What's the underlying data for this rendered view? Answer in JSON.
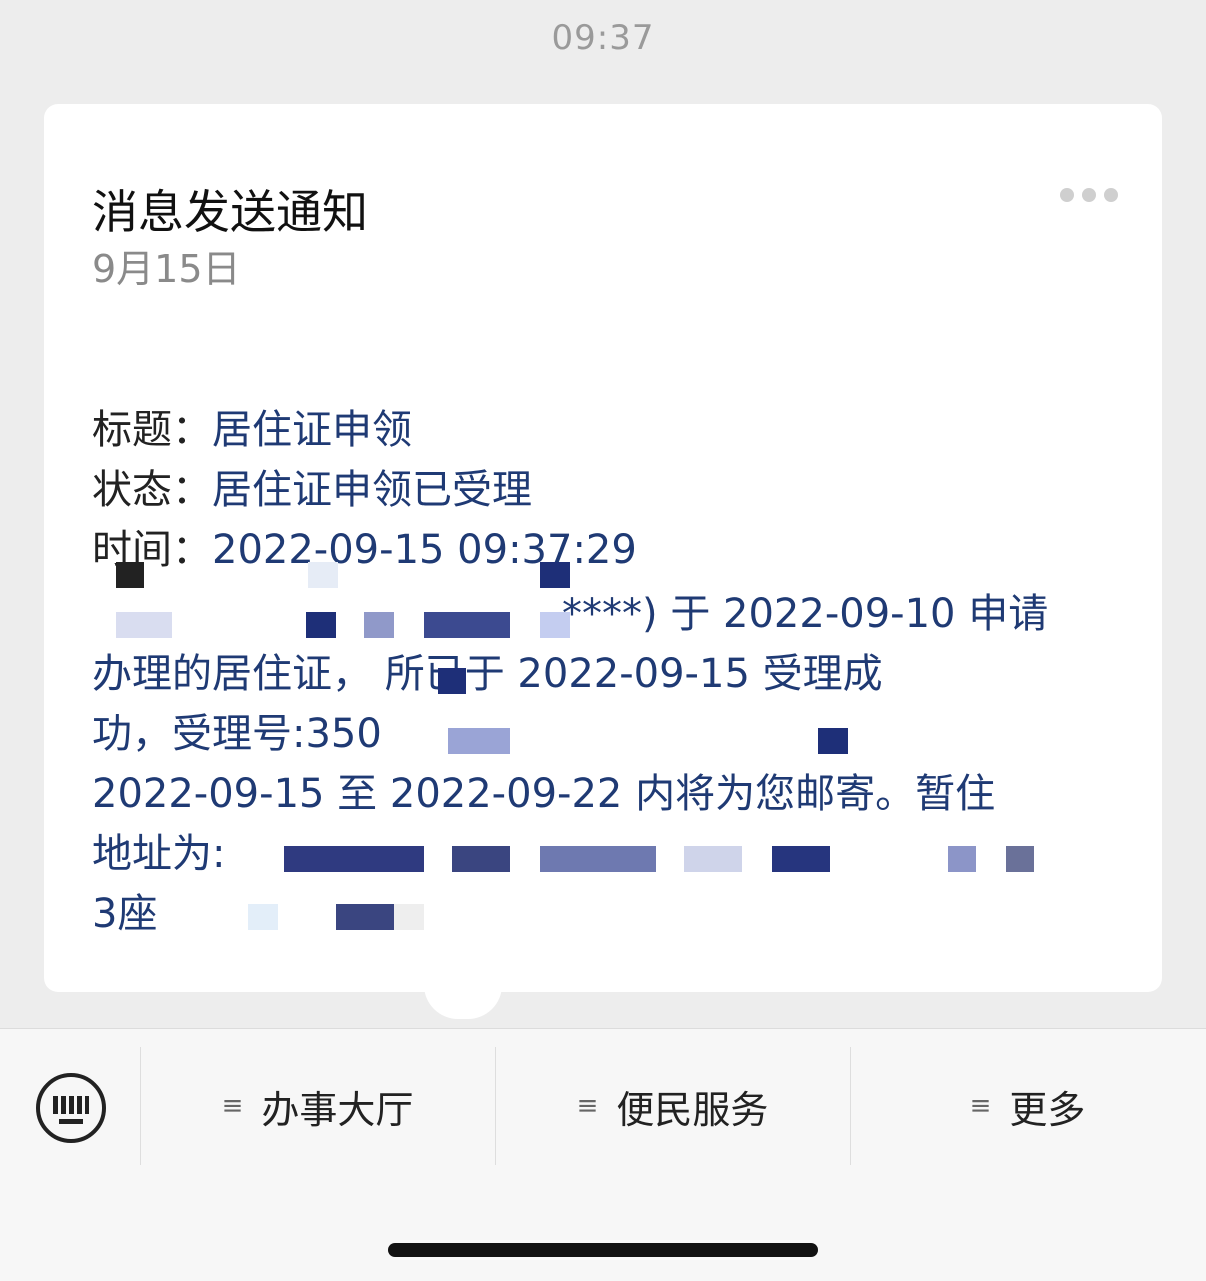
{
  "status_bar": {
    "time": "09:37"
  },
  "card": {
    "title": "消息发送通知",
    "date": "9月15日",
    "fields": [
      {
        "label": "标题：",
        "value": "居住证申领"
      },
      {
        "label": "状态：",
        "value": "居住证申领已受理"
      },
      {
        "label": "时间：",
        "value": "2022-09-15 09:37:29"
      }
    ],
    "body_lines": [
      "****) 于 2022-09-10 申请",
      "办理的居住证，   所已于 2022-09-15 受理成",
      "功，受理号:350",
      "2022-09-15 至 2022-09-22 内将为您邮寄。暂住",
      "地址为:",
      "3座"
    ]
  },
  "menu": {
    "items": [
      {
        "label": "办事大厅",
        "icon": "menu-lines-icon"
      },
      {
        "label": "便民服务",
        "icon": "menu-lines-icon"
      },
      {
        "label": "更多",
        "icon": "menu-lines-icon"
      }
    ],
    "keyboard_icon": "keyboard-icon"
  }
}
